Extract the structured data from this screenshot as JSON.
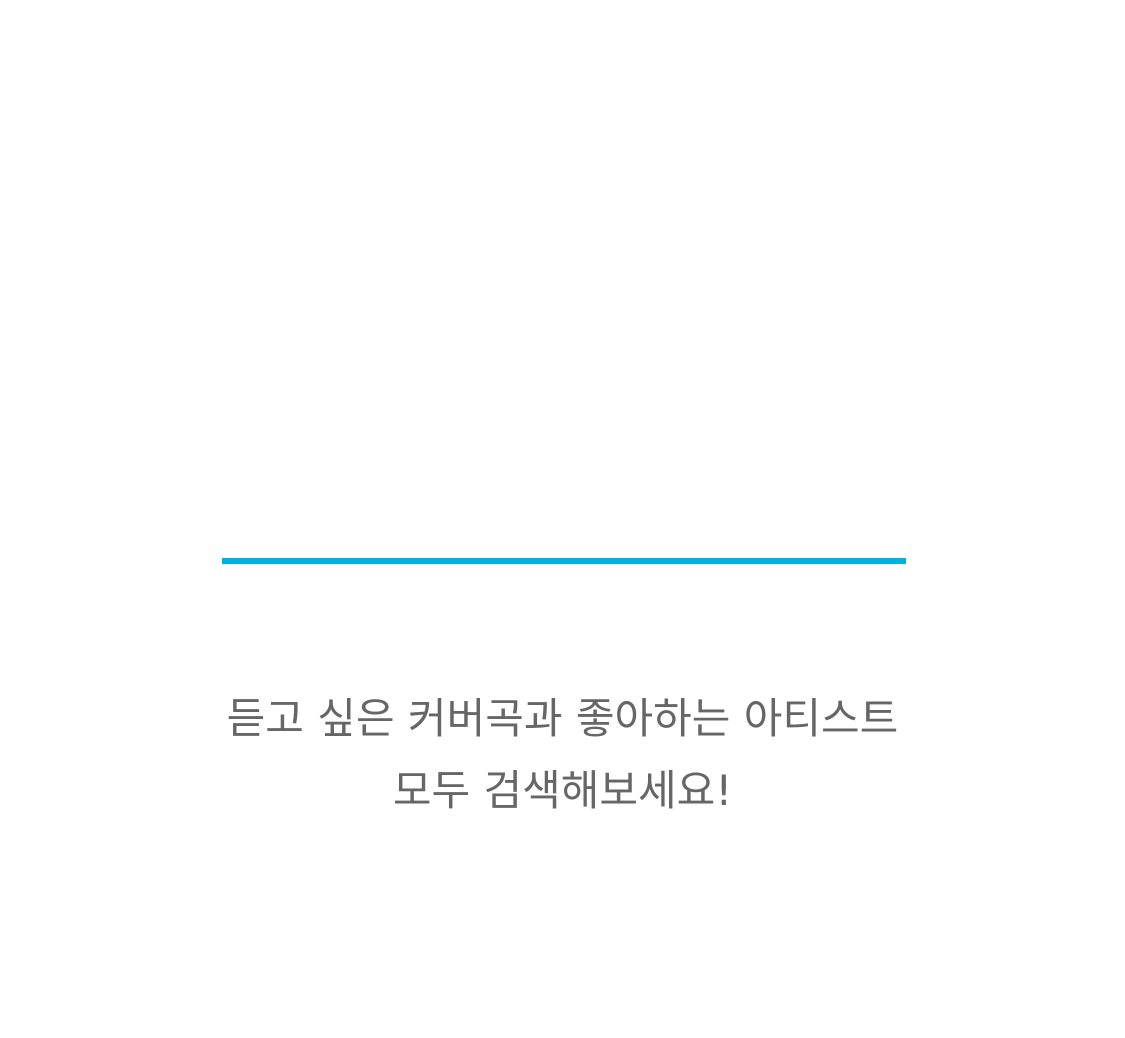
{
  "search": {
    "underline_color": "#00b2e0"
  },
  "empty_state": {
    "line1": "듣고 싶은 커버곡과 좋아하는 아티스트",
    "line2": "모두 검색해보세요!",
    "text_color": "#666666"
  }
}
